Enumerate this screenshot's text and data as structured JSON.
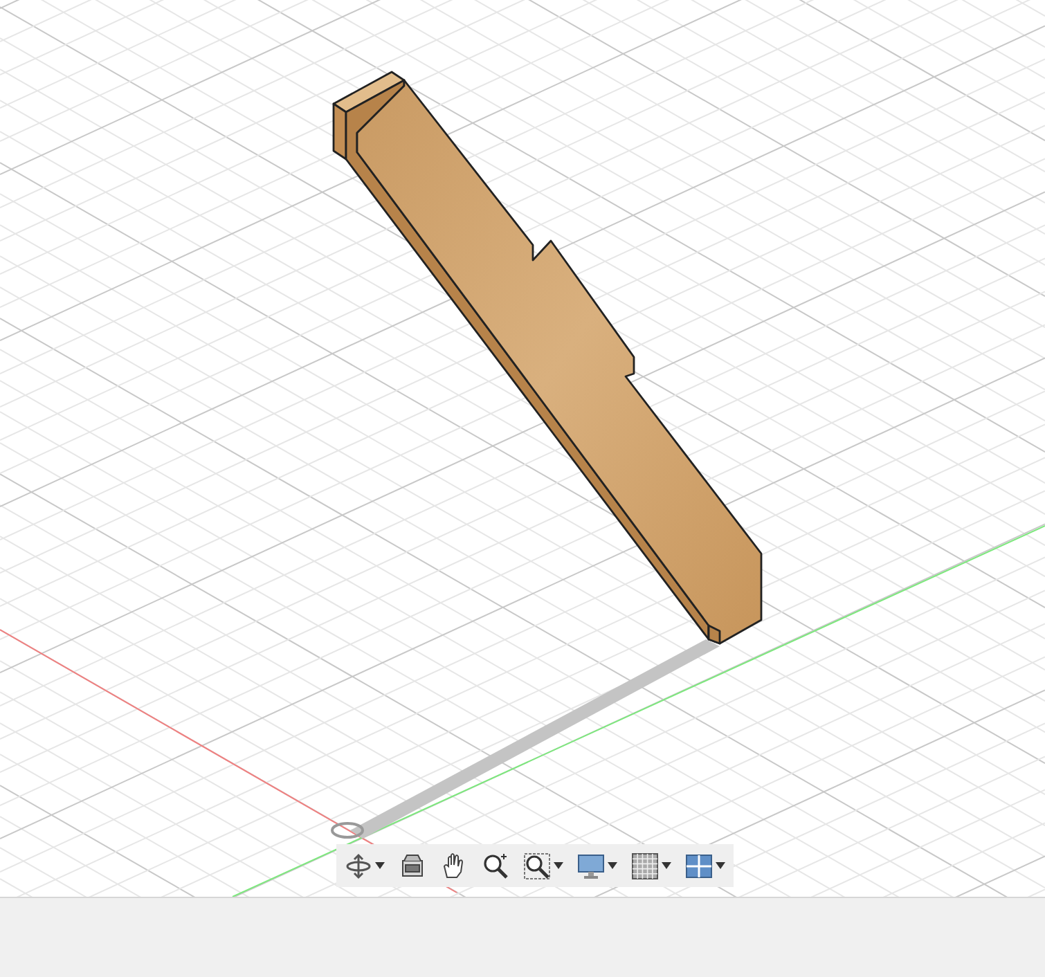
{
  "viewport": {
    "tools": [
      {
        "kind": "orbit",
        "dropdown": true
      },
      {
        "kind": "look",
        "dropdown": false
      },
      {
        "kind": "pan",
        "dropdown": false
      },
      {
        "kind": "zoom",
        "dropdown": false
      },
      {
        "kind": "fit",
        "dropdown": true
      },
      {
        "kind": "display",
        "dropdown": true
      },
      {
        "kind": "grid",
        "dropdown": true
      },
      {
        "kind": "viewports",
        "dropdown": true
      }
    ]
  }
}
